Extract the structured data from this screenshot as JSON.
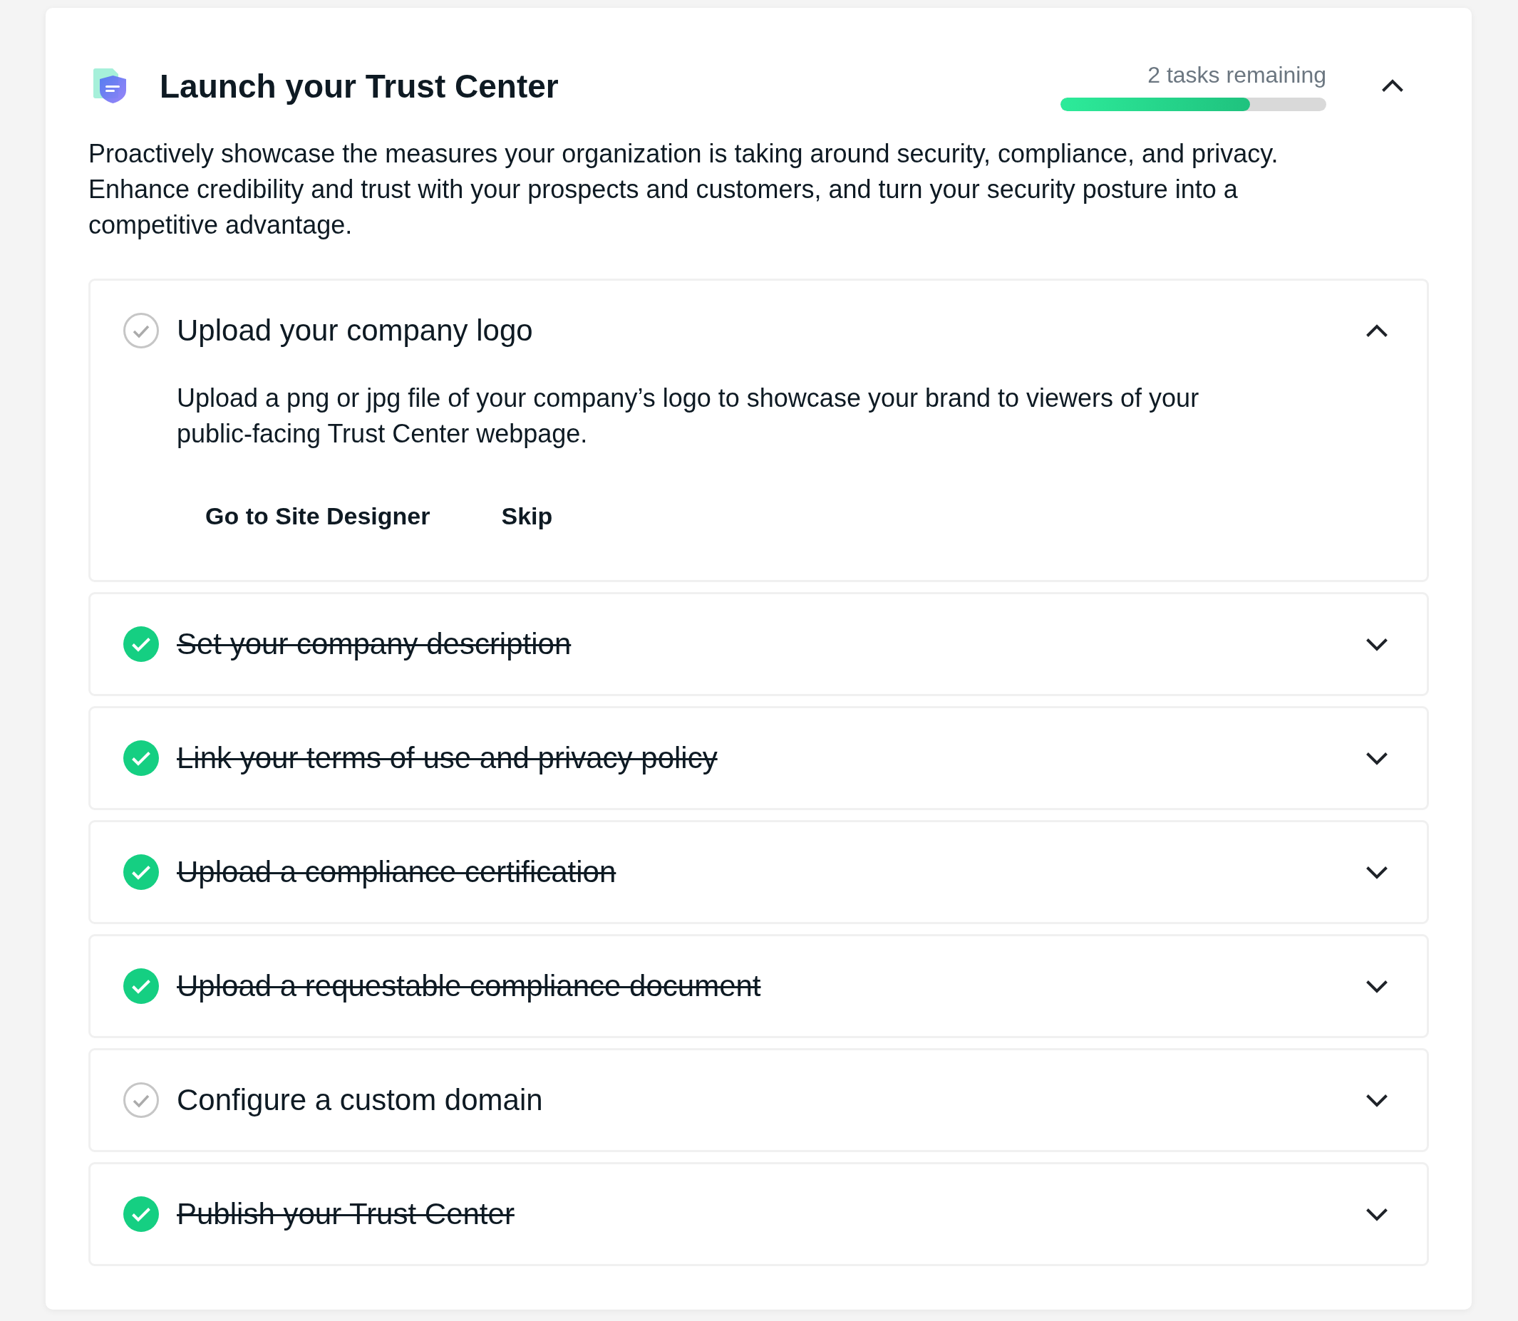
{
  "header": {
    "title": "Launch your Trust Center",
    "remaining": "2 tasks remaining",
    "progress": {
      "level": 0.714
    },
    "expanded": true
  },
  "intro": "Proactively showcase the measures your organization is taking around security, compliance, and privacy. Enhance credibility and trust with your prospects and customers, and turn your security posture into a competitive advantage.",
  "tasks": [
    {
      "title": "Upload your company logo",
      "done": false,
      "expanded": true,
      "description": "Upload a png or jpg file of your company’s logo to showcase your brand to viewers of your public-facing Trust Center webpage.",
      "actions": [
        "Go to Site Designer",
        "Skip"
      ]
    },
    {
      "title": "Set your company description",
      "done": true,
      "expanded": false
    },
    {
      "title": "Link your terms of use and privacy policy",
      "done": true,
      "expanded": false
    },
    {
      "title": "Upload a compliance certification",
      "done": true,
      "expanded": false
    },
    {
      "title": "Upload a requestable compliance document",
      "done": true,
      "expanded": false
    },
    {
      "title": "Configure a custom domain",
      "done": false,
      "expanded": false
    },
    {
      "title": "Publish your Trust Center",
      "done": true,
      "expanded": false
    }
  ]
}
